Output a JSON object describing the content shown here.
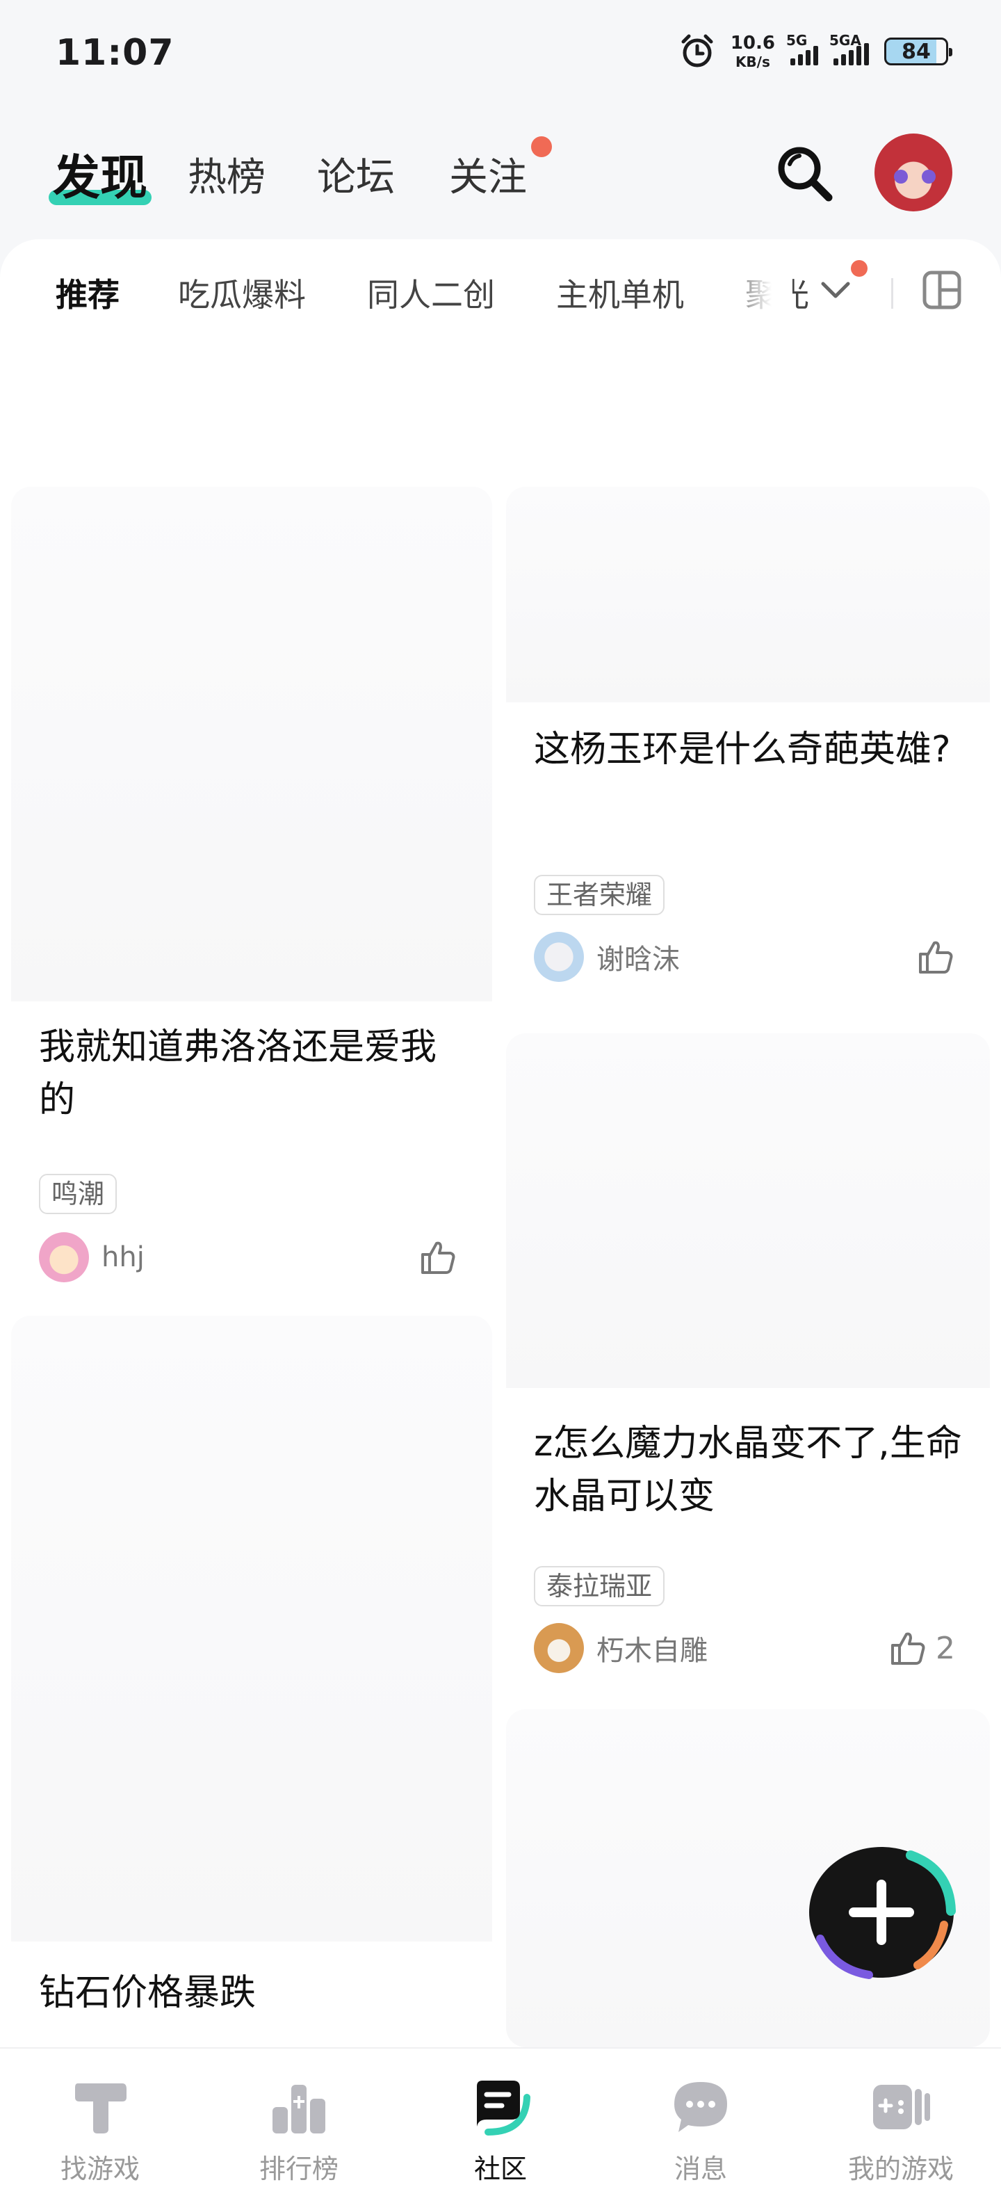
{
  "status_bar": {
    "time": "11:07",
    "net_speed": "10.6",
    "net_unit": "KB/s",
    "sim1": "5G",
    "sim2": "5GA",
    "battery": "84"
  },
  "top_tabs": [
    {
      "label": "发现",
      "active": true
    },
    {
      "label": "热榜",
      "active": false
    },
    {
      "label": "论坛",
      "active": false
    },
    {
      "label": "关注",
      "active": false,
      "badge": "red-dot"
    }
  ],
  "categories": [
    {
      "label": "推荐",
      "active": true
    },
    {
      "label": "吃瓜爆料",
      "active": false
    },
    {
      "label": "同人二创",
      "active": false
    },
    {
      "label": "主机单机",
      "active": false
    },
    {
      "label": "聚光",
      "active": false
    }
  ],
  "posts": [
    {
      "title": "我就知道弗洛洛还是爱我的",
      "tag": "鸣潮",
      "author": "hhj",
      "likes": ""
    },
    {
      "title": "这杨玉环是什么奇葩英雄?",
      "tag": "王者荣耀",
      "author": "谢晗沫",
      "likes": ""
    },
    {
      "title": "z怎么魔力水晶变不了,生命水晶可以变",
      "tag": "泰拉瑞亚",
      "author": "朽木自雕",
      "likes": "2"
    },
    {
      "title": "钻石价格暴跌",
      "tag": "",
      "author": "",
      "likes": ""
    }
  ],
  "bottom_nav": [
    {
      "label": "找游戏",
      "icon": "find-game-icon",
      "active": false
    },
    {
      "label": "排行榜",
      "icon": "ranking-icon",
      "active": false
    },
    {
      "label": "社区",
      "icon": "community-icon",
      "active": true
    },
    {
      "label": "消息",
      "icon": "message-icon",
      "active": false
    },
    {
      "label": "我的游戏",
      "icon": "my-games-icon",
      "active": false
    }
  ],
  "colors": {
    "accent": "#34d1b4",
    "badge": "#f06a55",
    "inactive": "#999999"
  }
}
